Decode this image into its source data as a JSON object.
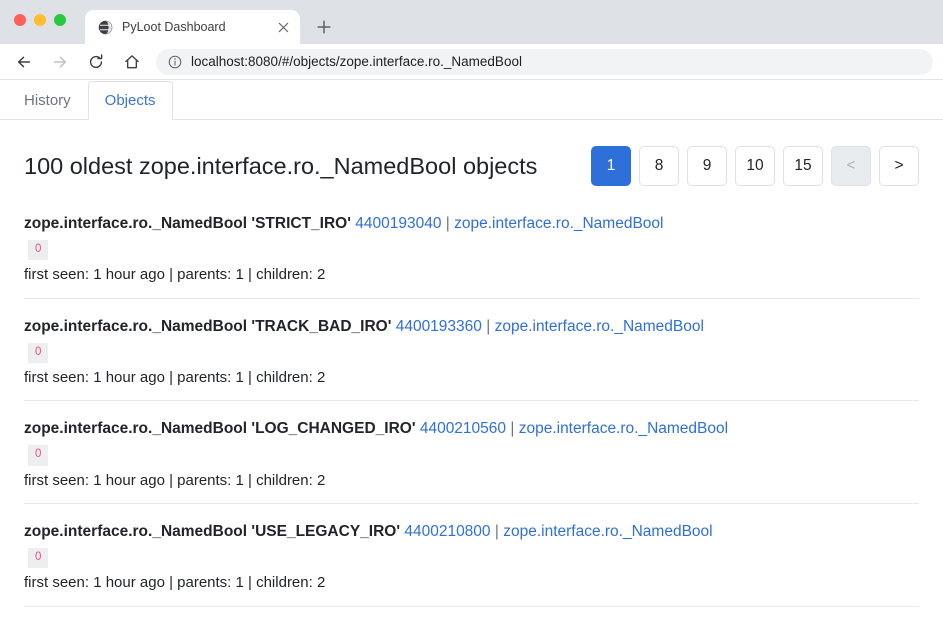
{
  "browser": {
    "window_controls": [
      "close",
      "minimize",
      "maximize"
    ],
    "tab": {
      "title": "PyLoot Dashboard",
      "favicon": "globe-icon",
      "close_label": "×"
    },
    "new_tab_label": "+",
    "toolbar": {
      "back_label": "←",
      "forward_label": "→",
      "reload_label": "⟳",
      "home_label": "⌂",
      "info_label": "ⓘ",
      "url": "localhost:8080/#/objects/zope.interface.ro._NamedBool"
    }
  },
  "app": {
    "tabs": [
      {
        "label": "History",
        "active": false
      },
      {
        "label": "Objects",
        "active": true
      }
    ],
    "title": "100 oldest zope.interface.ro._NamedBool objects",
    "pagination": [
      {
        "label": "1",
        "state": "active"
      },
      {
        "label": "8",
        "state": "normal"
      },
      {
        "label": "9",
        "state": "normal"
      },
      {
        "label": "10",
        "state": "normal"
      },
      {
        "label": "15",
        "state": "normal"
      },
      {
        "label": "<",
        "state": "disabled"
      },
      {
        "label": ">",
        "state": "normal"
      }
    ],
    "objects": [
      {
        "type_name": "zope.interface.ro._NamedBool",
        "instance_name": "'STRICT_IRO'",
        "address": "4400193040",
        "separator": "|",
        "type_link": "zope.interface.ro._NamedBool",
        "badge": "0",
        "meta": "first seen: 1 hour ago | parents: 1 | children: 2"
      },
      {
        "type_name": "zope.interface.ro._NamedBool",
        "instance_name": "'TRACK_BAD_IRO'",
        "address": "4400193360",
        "separator": "|",
        "type_link": "zope.interface.ro._NamedBool",
        "badge": "0",
        "meta": "first seen: 1 hour ago | parents: 1 | children: 2"
      },
      {
        "type_name": "zope.interface.ro._NamedBool",
        "instance_name": "'LOG_CHANGED_IRO'",
        "address": "4400210560",
        "separator": "|",
        "type_link": "zope.interface.ro._NamedBool",
        "badge": "0",
        "meta": "first seen: 1 hour ago | parents: 1 | children: 2"
      },
      {
        "type_name": "zope.interface.ro._NamedBool",
        "instance_name": "'USE_LEGACY_IRO'",
        "address": "4400210800",
        "separator": "|",
        "type_link": "zope.interface.ro._NamedBool",
        "badge": "0",
        "meta": "first seen: 1 hour ago | parents: 1 | children: 2"
      }
    ]
  },
  "colors": {
    "primary": "#2f6fda",
    "link": "#2f6fda",
    "badge_text": "#e8547c",
    "badge_bg": "#eceeef",
    "chrome_bg": "#dee1e6",
    "muted": "#6c757d"
  }
}
